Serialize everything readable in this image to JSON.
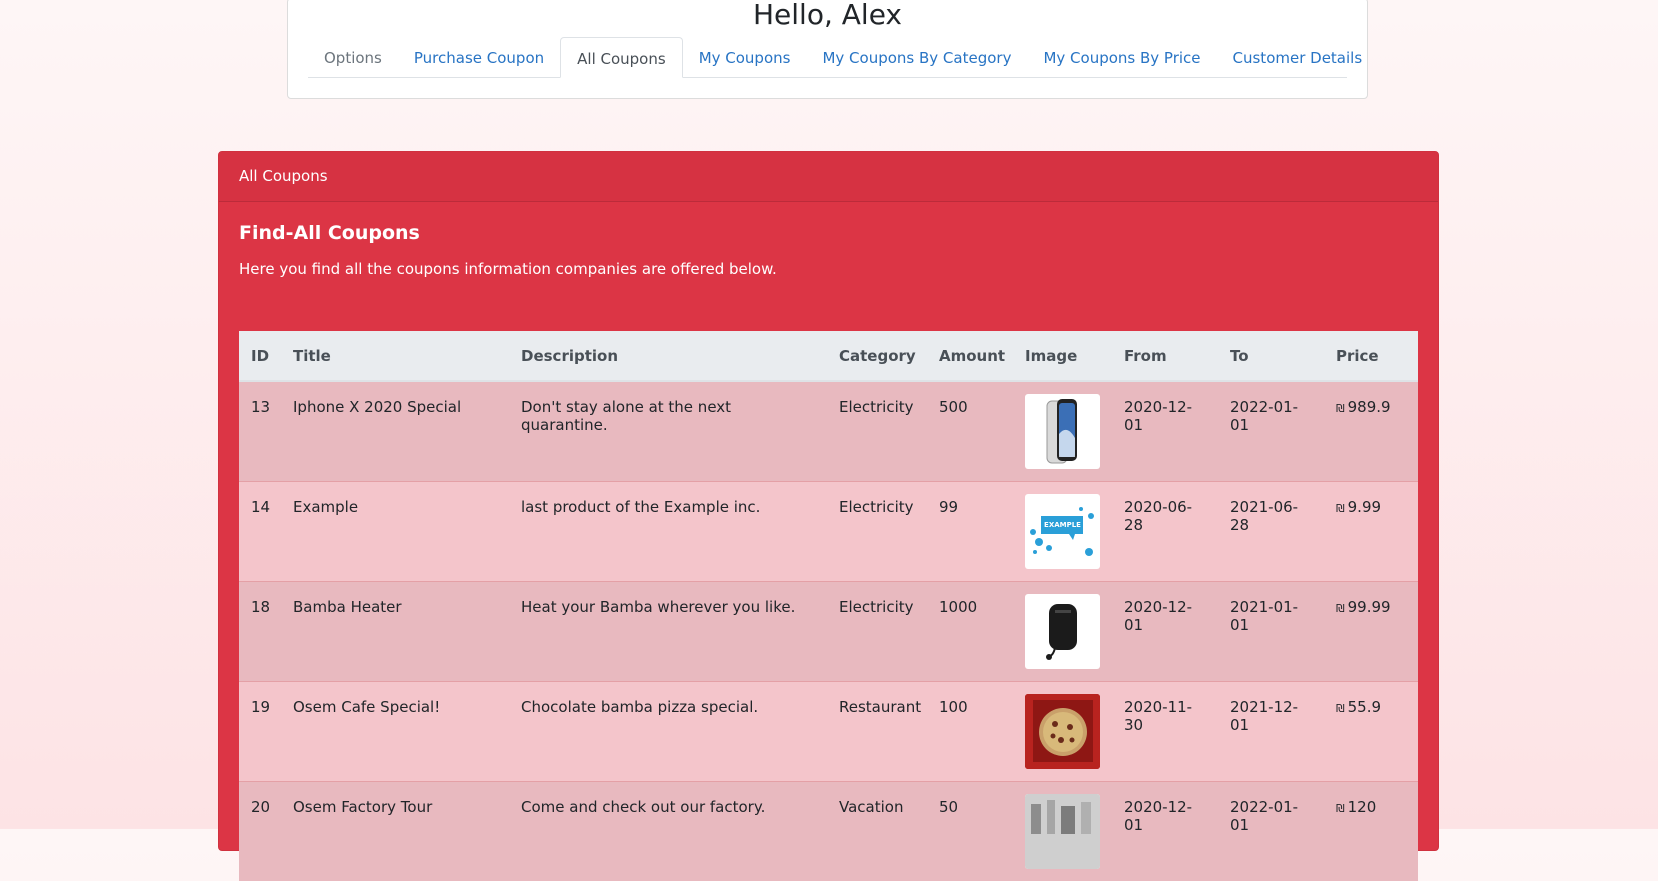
{
  "header": {
    "greeting": "Hello, Alex",
    "tabs": [
      {
        "label": "Options"
      },
      {
        "label": "Purchase Coupon"
      },
      {
        "label": "All Coupons"
      },
      {
        "label": "My Coupons"
      },
      {
        "label": "My Coupons By Category"
      },
      {
        "label": "My Coupons By Price"
      },
      {
        "label": "Customer Details"
      }
    ],
    "active_tab": "All Coupons"
  },
  "panel": {
    "header": "All Coupons",
    "title": "Find-All Coupons",
    "subtitle": "Here you find all the coupons information companies are offered below."
  },
  "table": {
    "columns": [
      "ID",
      "Title",
      "Description",
      "Category",
      "Amount",
      "Image",
      "From",
      "To",
      "Price"
    ],
    "currency_symbol": "₪",
    "rows": [
      {
        "id": "13",
        "title": "Iphone X 2020 Special",
        "description": "Don't stay alone at the next quarantine.",
        "category": "Electricity",
        "amount": "500",
        "image": "phone-image",
        "from": "2020-12-01",
        "to": "2022-01-01",
        "price": "989.9"
      },
      {
        "id": "14",
        "title": "Example",
        "description": "last product of the Example inc.",
        "category": "Electricity",
        "amount": "99",
        "image": "example-logo-image",
        "image_text": "EXAMPLE",
        "from": "2020-06-28",
        "to": "2021-06-28",
        "price": "9.99"
      },
      {
        "id": "18",
        "title": "Bamba Heater",
        "description": "Heat your Bamba wherever you like.",
        "category": "Electricity",
        "amount": "1000",
        "image": "heater-image",
        "from": "2020-12-01",
        "to": "2021-01-01",
        "price": "99.99"
      },
      {
        "id": "19",
        "title": "Osem Cafe Special!",
        "description": "Chocolate bamba pizza special.",
        "category": "Restaurant",
        "amount": "100",
        "image": "pizza-image",
        "from": "2020-11-30",
        "to": "2021-12-01",
        "price": "55.9"
      },
      {
        "id": "20",
        "title": "Osem Factory Tour",
        "description": "Come and check out our factory.",
        "category": "Vacation",
        "amount": "50",
        "image": "factory-image",
        "from": "2020-12-01",
        "to": "2022-01-01",
        "price": "120"
      }
    ]
  },
  "colors": {
    "panel": "#dc3545",
    "link": "#2874c4",
    "row_odd": "#e8b9bf",
    "row_even": "#f4c5cb"
  }
}
